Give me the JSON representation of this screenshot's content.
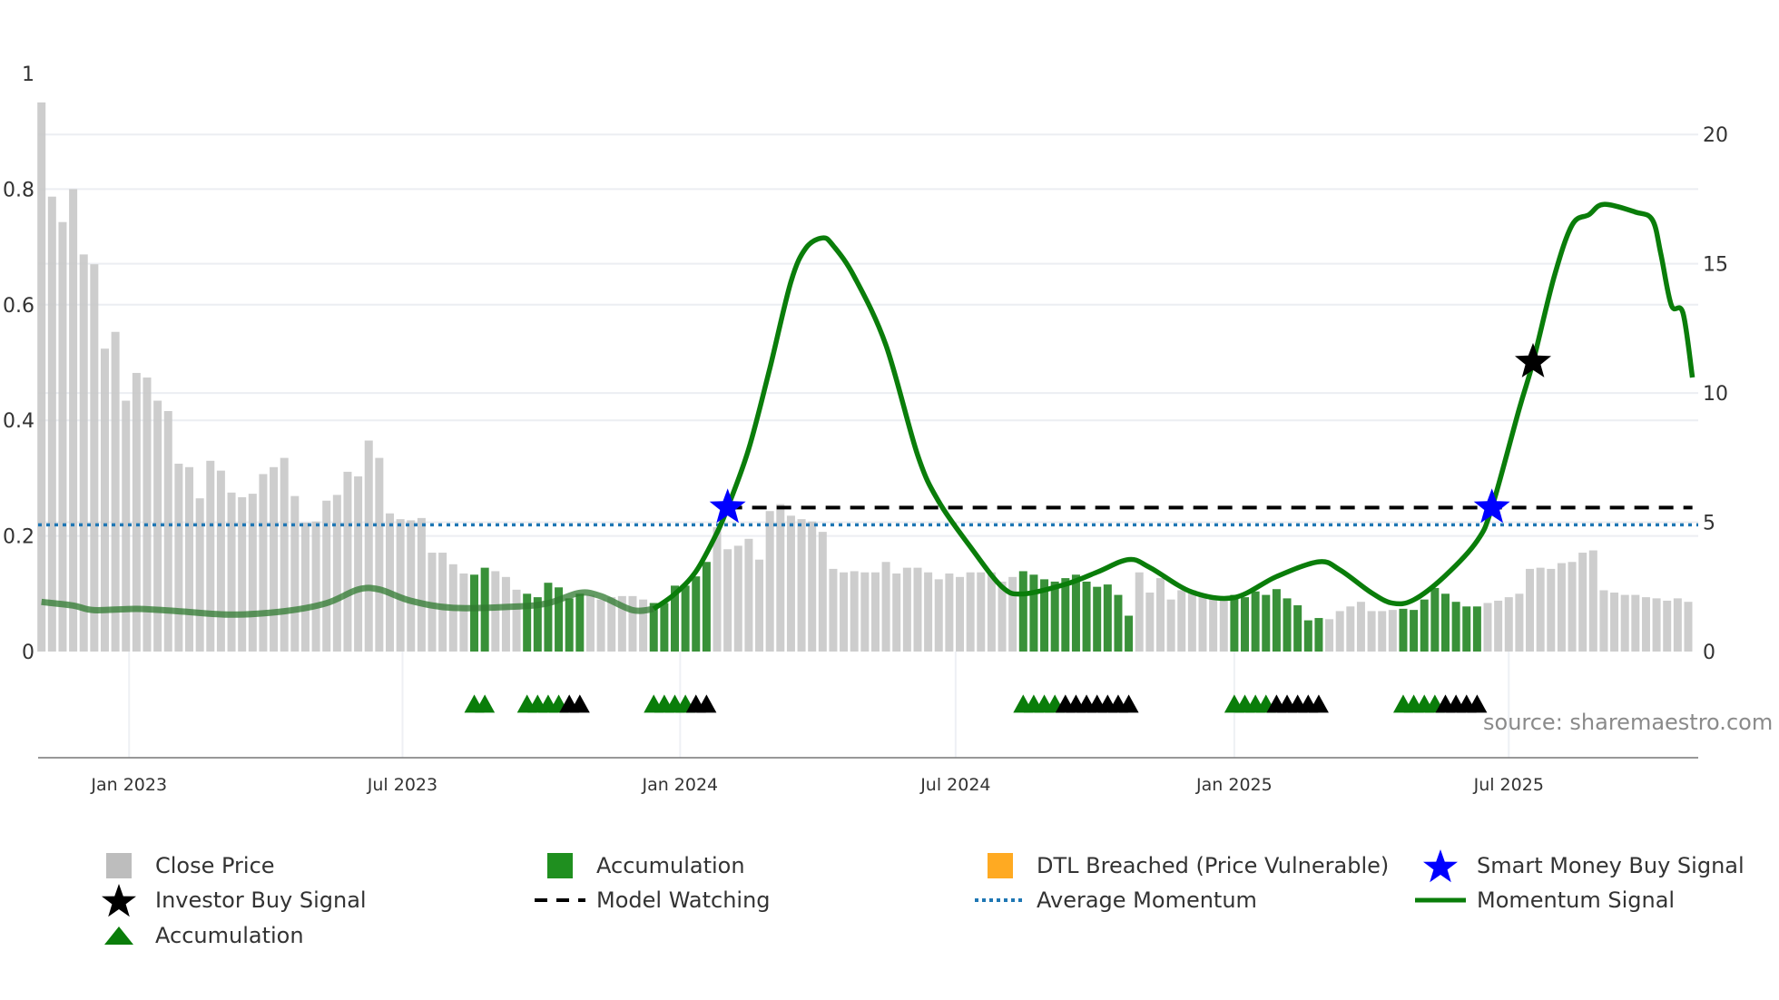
{
  "chart_data": {
    "type": "bar+line",
    "title": "",
    "left_axis": {
      "ylim": [
        0,
        1
      ],
      "ticks": [
        0,
        0.2,
        0.4,
        0.6,
        0.8,
        1
      ],
      "tick_labels": [
        "0",
        "0.2",
        "0.4",
        "0.6",
        "0.8",
        "1"
      ]
    },
    "right_axis": {
      "ylim": [
        0,
        22.36
      ],
      "ticks": [
        0,
        5,
        10,
        15,
        20
      ],
      "tick_labels": [
        "0",
        "5",
        "10",
        "15",
        "20"
      ]
    },
    "x_axis": {
      "unit": "week index",
      "ticks": [
        8.3,
        34.2,
        60.5,
        86.6,
        113,
        139
      ],
      "tick_labels": [
        "Jan 2023",
        "Jul 2023",
        "Jan 2024",
        "Jul 2024",
        "Jan 2025",
        "Jul 2025"
      ]
    },
    "grid": true,
    "close_price": [
      0.95,
      0.787,
      0.743,
      0.8,
      0.687,
      0.67,
      0.524,
      0.553,
      0.434,
      0.482,
      0.474,
      0.434,
      0.416,
      0.325,
      0.319,
      0.265,
      0.33,
      0.313,
      0.275,
      0.267,
      0.273,
      0.307,
      0.319,
      0.335,
      0.269,
      0.223,
      0.225,
      0.261,
      0.271,
      0.311,
      0.303,
      0.365,
      0.335,
      0.239,
      0.229,
      0.227,
      0.231,
      0.171,
      0.171,
      0.151,
      0.135,
      0.133,
      0.145,
      0.139,
      0.129,
      0.107,
      0.1,
      0.094,
      0.119,
      0.111,
      0.092,
      0.1,
      0.098,
      0.09,
      0.094,
      0.096,
      0.096,
      0.09,
      0.084,
      0.084,
      0.114,
      0.114,
      0.13,
      0.155,
      0.215,
      0.177,
      0.183,
      0.195,
      0.159,
      0.243,
      0.255,
      0.235,
      0.229,
      0.225,
      0.207,
      0.143,
      0.137,
      0.139,
      0.137,
      0.137,
      0.155,
      0.135,
      0.145,
      0.145,
      0.137,
      0.125,
      0.135,
      0.129,
      0.137,
      0.137,
      0.137,
      0.121,
      0.129,
      0.139,
      0.133,
      0.125,
      0.121,
      0.127,
      0.133,
      0.121,
      0.112,
      0.116,
      0.098,
      0.062,
      0.137,
      0.102,
      0.127,
      0.09,
      0.106,
      0.106,
      0.1,
      0.096,
      0.092,
      0.098,
      0.094,
      0.104,
      0.098,
      0.108,
      0.092,
      0.08,
      0.054,
      0.058,
      0.056,
      0.07,
      0.078,
      0.086,
      0.07,
      0.07,
      0.072,
      0.074,
      0.072,
      0.09,
      0.11,
      0.1,
      0.086,
      0.078,
      0.078,
      0.084,
      0.088,
      0.094,
      0.1,
      0.143,
      0.145,
      0.143,
      0.153,
      0.155,
      0.171,
      0.175,
      0.106,
      0.102,
      0.098,
      0.098,
      0.094,
      0.092,
      0.088,
      0.092,
      0.086
    ],
    "accumulation_ranges": [
      [
        41,
        42
      ],
      [
        46,
        51
      ],
      [
        58,
        63
      ],
      [
        93,
        103
      ],
      [
        113,
        121
      ],
      [
        129,
        136
      ]
    ],
    "momentum_signal": [
      [
        0,
        1.92
      ],
      [
        3,
        1.78
      ],
      [
        5,
        1.6
      ],
      [
        9,
        1.65
      ],
      [
        13,
        1.56
      ],
      [
        18,
        1.43
      ],
      [
        23,
        1.56
      ],
      [
        27,
        1.87
      ],
      [
        30,
        2.4
      ],
      [
        32,
        2.4
      ],
      [
        35,
        1.96
      ],
      [
        39,
        1.69
      ],
      [
        45,
        1.74
      ],
      [
        48,
        1.87
      ],
      [
        51,
        2.27
      ],
      [
        53,
        2.14
      ],
      [
        56,
        1.6
      ],
      [
        58,
        1.65
      ],
      [
        60,
        2.23
      ],
      [
        62,
        3.1
      ],
      [
        64,
        4.6
      ],
      [
        65,
        5.57
      ],
      [
        67,
        7.84
      ],
      [
        69,
        10.96
      ],
      [
        71,
        14.3
      ],
      [
        72.4,
        15.6
      ],
      [
        74,
        16.0
      ],
      [
        75,
        15.7
      ],
      [
        77,
        14.5
      ],
      [
        80,
        11.85
      ],
      [
        83,
        7.6
      ],
      [
        85,
        5.8
      ],
      [
        88,
        4.05
      ],
      [
        91,
        2.5
      ],
      [
        93,
        2.23
      ],
      [
        97,
        2.6
      ],
      [
        100,
        3.07
      ],
      [
        103,
        3.56
      ],
      [
        105,
        3.25
      ],
      [
        109,
        2.3
      ],
      [
        113,
        2.09
      ],
      [
        117,
        2.9
      ],
      [
        121,
        3.47
      ],
      [
        123,
        3.16
      ],
      [
        126,
        2.27
      ],
      [
        128,
        1.87
      ],
      [
        130,
        2.0
      ],
      [
        133,
        2.94
      ],
      [
        136,
        4.28
      ],
      [
        137.4,
        5.57
      ],
      [
        140,
        9.4
      ],
      [
        141.3,
        11.2
      ],
      [
        143.3,
        14.5
      ],
      [
        145,
        16.5
      ],
      [
        146.6,
        16.9
      ],
      [
        148,
        17.3
      ],
      [
        151,
        17.0
      ],
      [
        152.6,
        16.7
      ],
      [
        153.4,
        15.4
      ],
      [
        154.4,
        13.4
      ],
      [
        155.5,
        13.1
      ],
      [
        156.4,
        10.6
      ]
    ],
    "momentum_faded_until": 58,
    "average_momentum": 4.9,
    "model_watching": {
      "from": 65,
      "to": 156.4,
      "value": 5.57
    },
    "smart_money_buy_signals": [
      [
        65,
        5.57
      ],
      [
        137.4,
        5.57
      ]
    ],
    "investor_buy_signals": [
      [
        141.3,
        11.2
      ]
    ],
    "accumulation_markers": [
      41,
      42,
      46,
      47,
      48,
      49,
      58,
      59,
      60,
      61,
      93,
      94,
      95,
      96,
      113,
      114,
      115,
      116,
      129,
      130,
      131,
      132
    ],
    "vulnerable_markers": [
      50,
      51,
      62,
      63,
      97,
      98,
      99,
      100,
      101,
      102,
      103,
      117,
      118,
      119,
      120,
      121,
      133,
      134,
      135,
      136
    ],
    "marker_level": -0.09,
    "colors": {
      "close": "#c8c8c8",
      "accumulation_bar": "#2e8b2e",
      "momentum": "#0a7d0a",
      "avg": "#1f77b4",
      "watch": "#000000",
      "smart": "#0000ff",
      "dtl": "#ffaa22"
    },
    "legend": [
      {
        "label": "Close Price",
        "icon": "grey-square"
      },
      {
        "label": "Accumulation",
        "icon": "green-square"
      },
      {
        "label": "DTL Breached (Price Vulnerable)",
        "icon": "orange-square"
      },
      {
        "label": "Smart Money Buy Signal",
        "icon": "blue-star"
      },
      {
        "label": "Investor Buy Signal",
        "icon": "black-star"
      },
      {
        "label": "Model Watching",
        "icon": "black-dashed-line"
      },
      {
        "label": "Average Momentum",
        "icon": "blue-dotted-line"
      },
      {
        "label": "Momentum Signal",
        "icon": "green-line"
      },
      {
        "label": "Accumulation",
        "icon": "green-triangle"
      }
    ],
    "source": "source: sharemaestro.com"
  }
}
